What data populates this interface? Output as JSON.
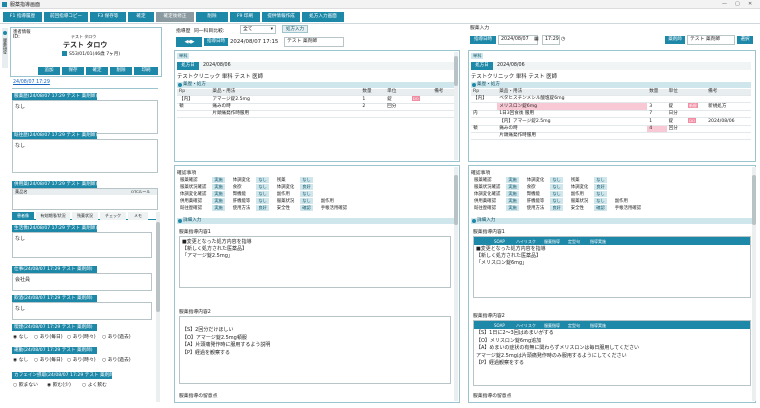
{
  "window": {
    "title": "服薬指導画面",
    "controls": [
      "—",
      "▢",
      "✕"
    ]
  },
  "toolbar": [
    "F1 指導履歴",
    "前回指導コピー",
    "F3 保存等",
    "確定",
    "確定後修正",
    "削除",
    "F9 印刷",
    "提供情報作成",
    "処方入力画面"
  ],
  "patient": {
    "label_header": "患者情報",
    "id_label": "ID:",
    "kana": "テスト タロウ",
    "name": "テスト タロウ",
    "birth": "S53/01/01(46歳 7ヶ月)",
    "actions": [
      "追加",
      "保存",
      "確定",
      "削除",
      "印刷"
    ],
    "side_tab": "服薬指導",
    "date_link": "24/08/07 17:29"
  },
  "left_notes": [
    {
      "header": "服薬歴(24/08/07 17:29 テスト 薬剤師)",
      "text": "なし"
    },
    {
      "header": "既往歴(24/08/07 17:29 テスト 薬剤師)",
      "text": "なし"
    },
    {
      "header": "併用薬(24/08/07 17:29 テスト 薬剤師)",
      "col1": "薬品名",
      "col2": "OTCルール"
    }
  ],
  "left_tabs": [
    "患者像",
    "有効期限/状況",
    "残薬状況",
    "チェック",
    "メモ"
  ],
  "left_notes2": [
    {
      "header": "生活像(24/08/07 17:29 テスト 薬剤師)",
      "text": "なし"
    },
    {
      "header": "仕事(24/08/07 17:29 テスト 薬剤師)",
      "text": "会社員"
    },
    {
      "header": "飲酒(24/08/07 17:29 テスト 薬剤師)",
      "text": "なし"
    },
    {
      "header": "喫煙(24/08/07 17:29 テスト 薬剤師)",
      "options": [
        "なし",
        "あり(毎日)",
        "あり(時々)",
        "あり(過去)"
      ]
    },
    {
      "header": "運動(24/08/07 17:29 テスト 薬剤師)",
      "options": [
        "なし",
        "あり(毎日)",
        "あり(時々)",
        "あり(過去)"
      ]
    },
    {
      "header": "カフェイン摂取(24/08/07 17:29 テスト 薬剤師)",
      "options": [
        "飲まない",
        "飲む(少)",
        "よく飲む"
      ]
    }
  ],
  "mid": {
    "history_label": "指導歴",
    "compare_label": "同一科目比較:",
    "compare_value": "全て",
    "presc_btn": "処方入力",
    "date_label": "指導日時",
    "date_value": "2024/08/07 17:15",
    "pharmacist": "テスト 薬剤師",
    "dept_tag": "単科",
    "presc_label": "処方日",
    "presc_date": "2024/08/06",
    "clinic": "テストクリニック 単科 テスト 医師",
    "section_med": "薬歴・処方",
    "med_cols": [
      "Rp",
      "薬品・用法",
      "数量",
      "単位",
      "",
      "備考"
    ],
    "meds": [
      {
        "rp": "【内】",
        "name": "アマージ錠2.5mg",
        "qty": "1",
        "unit": "錠",
        "note": ""
      },
      {
        "rp": "頓",
        "name": "痛みの時",
        "qty": "2",
        "unit": "回分",
        "note": ""
      },
      {
        "rp": "",
        "name": "片頭痛発作時服用",
        "qty": "",
        "unit": "",
        "note": ""
      }
    ],
    "section_check": "確認事項",
    "section_detail": "詳細入力",
    "guide1_label": "服薬指導内容1",
    "guide1_lines": [
      "■変更となった処方内容を指導",
      "【新しく処方された医薬品】",
      "「アマージ錠2.5mg」"
    ],
    "guide2_label": "服薬指導内容2",
    "guide2_lines": [
      "【S】2回分だけほしい",
      "【O】アマージ錠2.5mg頓服",
      "【A】片頭痛発作時に服用するよう説明",
      "【P】経過を観察する"
    ],
    "bottom_label": "服薬指導の留意点"
  },
  "checks": {
    "col1": [
      "服薬確認",
      "服薬状況確認",
      "体調変化確認",
      "併用薬確認",
      "既往歴確認"
    ],
    "col2": [
      "実施",
      "実施",
      "実施",
      "実施",
      "実施"
    ],
    "col3": [
      "体調変化",
      "食欲",
      "腎機能",
      "肝機能等",
      "使用方法"
    ],
    "col4": [
      "なし",
      "なし",
      "なし",
      "なし",
      "良好"
    ],
    "col5": [
      "残薬",
      "体調変化",
      "副作用",
      "服薬状況",
      "安全性"
    ],
    "col6": [
      "なし",
      "良好",
      "なし",
      "なし",
      "確認"
    ],
    "col7": [
      "",
      "",
      "",
      "副作用",
      "手帳活用確認"
    ]
  },
  "right": {
    "header_label": "服薬入力",
    "date_label": "指導日時",
    "date_value": "2024/08/07",
    "time_value": "17:29",
    "dept_tag": "薬剤師",
    "pharmacist": "テスト 薬剤師",
    "select_btn": "選択",
    "single_tag": "単科",
    "presc_label": "処方日",
    "presc_date": "2024/08/06",
    "clinic": "テストクリニック 単科 テスト 医師",
    "section_med": "薬歴・処方",
    "med_cols": [
      "Rp",
      "薬品・用法",
      "数量",
      "単位",
      "",
      "備考"
    ],
    "meds": [
      {
        "rp": "【内】",
        "name": "ベタヒスチンメシル酸塩錠6mg",
        "qty": "",
        "unit": "",
        "badge": "",
        "note": "",
        "pink": false
      },
      {
        "rp": "",
        "name": "メリスロン錠6mg",
        "qty": "3",
        "unit": "錠",
        "badge": "新規",
        "note": "新規処方",
        "pink": true
      },
      {
        "rp": "内",
        "name": "1日3回食後 服用",
        "qty": "7",
        "unit": "日分",
        "badge": "",
        "note": "",
        "pink": false
      },
      {
        "rp": "",
        "name": "【内】アマージ錠2.5mg",
        "qty": "1",
        "unit": "錠",
        "badge": "DO",
        "note": "2024/08/06",
        "pink": false
      },
      {
        "rp": "頓",
        "name": "痛みの時",
        "qty": "4",
        "unit": "回分",
        "badge": "",
        "note": "",
        "pink": false
      },
      {
        "rp": "",
        "name": "片頭痛発作時服用",
        "qty": "",
        "unit": "",
        "badge": "",
        "note": "",
        "pink": false
      }
    ],
    "section_check": "確認事項",
    "section_detail": "詳細入力",
    "guide1_label": "服薬指導内容1",
    "guide1_tabs": [
      "SOAP",
      "ハイリスク",
      "服薬指導",
      "定型句",
      "指導実施"
    ],
    "guide1_lines": [
      "■変更となった処方内容を指導",
      "【新しく処方された医薬品】",
      "「メリスロン錠6mg」"
    ],
    "guide2_label": "服薬指導内容2",
    "guide2_tabs": [
      "SOAP",
      "ハイリスク",
      "服薬指導",
      "定型句",
      "指導実施"
    ],
    "guide2_lines": [
      "【S】1日に2〜3回はめまいがする",
      "【O】メリスロン錠6mg追加",
      "【A】めまいの症状の有無に関わらずメリスロンは毎日服用してください",
      "アマージ錠2.5mgは片頭痛発作時のみ服用するようにしてください",
      "【P】経過観察をする"
    ],
    "bottom_label": "服薬指導の留意点"
  }
}
